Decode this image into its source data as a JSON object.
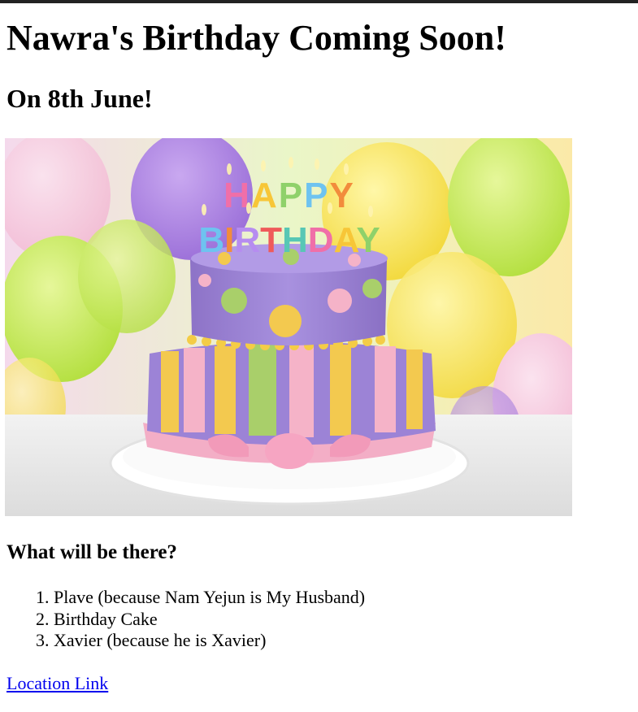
{
  "page": {
    "heading": "Nawra's Birthday Coming Soon!",
    "subheading": "On 8th June!",
    "section_title": "What will be there?",
    "items": [
      "Plave (because Nam Yejun is My Husband)",
      "Birthday Cake",
      "Xavier (because he is Xavier)"
    ],
    "link_text": "Location Link",
    "image": {
      "candles_line1": "HAPPY",
      "candles_line2": "BIRTHDAY"
    }
  },
  "colors": {
    "link": "#0000ee",
    "top_border": "#222222",
    "cake_purple": "#9c83d6",
    "cake_pink": "#f5b3c8",
    "cake_yellow": "#f3c94f",
    "cake_green": "#a9cf6a"
  }
}
